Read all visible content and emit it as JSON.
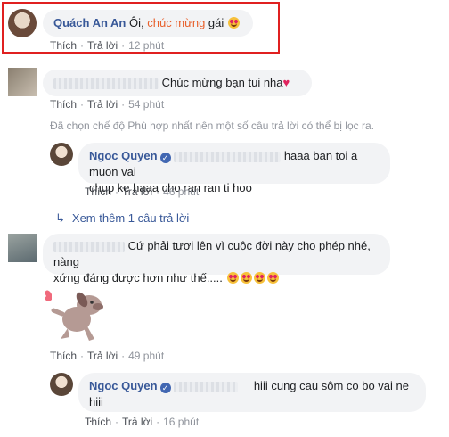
{
  "colors": {
    "link": "#385898",
    "highlight": "#e8602c",
    "frame": "#e02020",
    "bubble": "#f2f3f5"
  },
  "comments": [
    {
      "author": "Quách An An",
      "text_before": "Ôi, ",
      "text_highlight": "chúc mừng",
      "text_after": " gái",
      "emoji": "heart-eyes-emoji",
      "actions": {
        "like": "Thích",
        "reply": "Trả lời",
        "time": "12 phút"
      }
    },
    {
      "text": "Chúc mừng bạn tui nha",
      "emoji": "heart-icon",
      "actions": {
        "like": "Thích",
        "reply": "Trả lời",
        "time": "54 phút"
      }
    },
    {
      "author": "Ngoc Quyen",
      "text_line1": "haaa ban toi a muon vai",
      "text_line2": "chụp ke haaa cho ran ran ti hoo",
      "actions": {
        "like": "Thích",
        "reply": "Trả lời",
        "time": "46 phút"
      }
    },
    {
      "text_line1": "Cứ phải tươi lên vì cuộc đời này cho phép nhé, nàng",
      "text_line2": "xứng đáng được hơn như thế.....",
      "actions": {
        "like": "Thích",
        "reply": "Trả lời",
        "time": "49 phút"
      }
    },
    {
      "author": "Ngoc Quyen",
      "text_line1": "hiii cung cau sôm co bo vai ne hiii",
      "text_line2": ".",
      "actions": {
        "like": "Thích",
        "reply": "Trả lời",
        "time": "16 phút"
      }
    }
  ],
  "filter_notice": "Đã chọn chế độ Phù hợp nhất nên một số câu trả lời có thể bị lọc ra.",
  "see_more": "Xem thêm 1 câu trả lời"
}
